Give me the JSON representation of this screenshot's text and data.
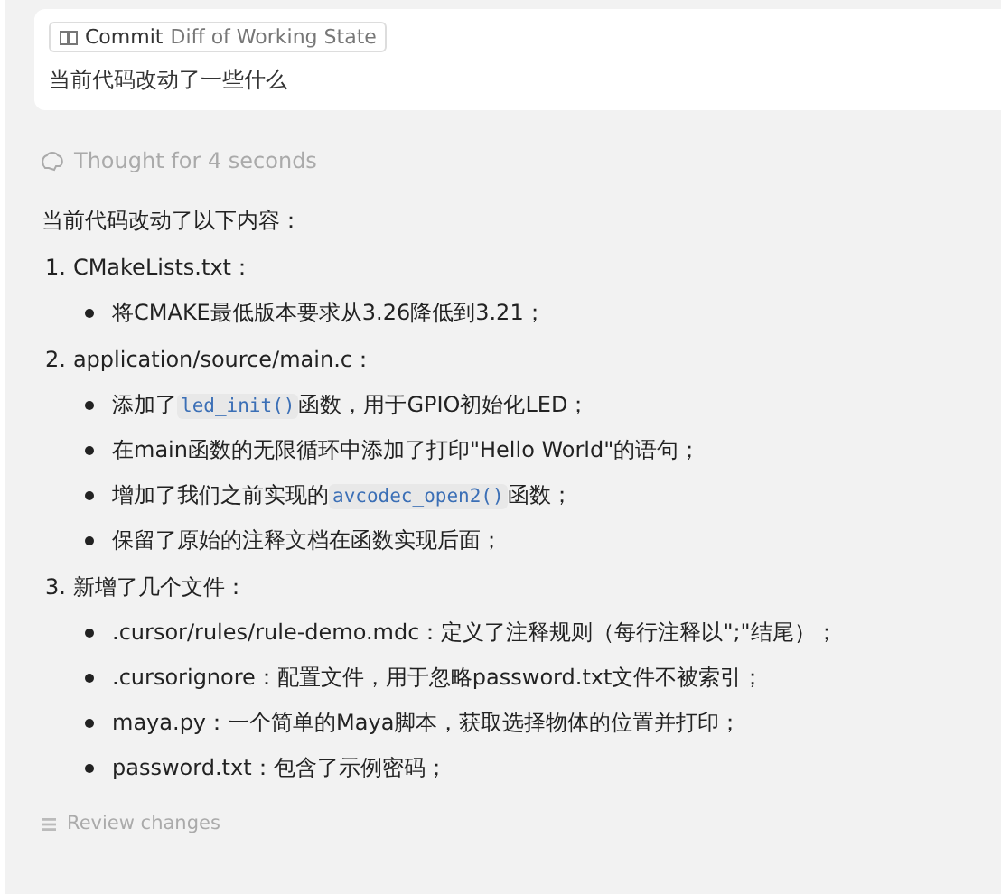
{
  "prompt_card": {
    "tag": {
      "label": "Commit",
      "detail": "Diff of Working State"
    },
    "message": "当前代码改动了一些什么"
  },
  "thought": {
    "label": "Thought for 4 seconds"
  },
  "answer": {
    "intro": "当前代码改动了以下内容：",
    "sections": [
      {
        "number": "1.",
        "title": "CMakeLists.txt：",
        "bullets": [
          [
            {
              "kind": "text",
              "text": "将CMAKE最低版本要求从3.26降低到3.21；"
            }
          ]
        ]
      },
      {
        "number": "2.",
        "title": "application/source/main.c：",
        "bullets": [
          [
            {
              "kind": "text",
              "text": "添加了"
            },
            {
              "kind": "code",
              "text": "led_init()"
            },
            {
              "kind": "text",
              "text": "函数，用于GPIO初始化LED；"
            }
          ],
          [
            {
              "kind": "text",
              "text": "在main函数的无限循环中添加了打印\"Hello World\"的语句；"
            }
          ],
          [
            {
              "kind": "text",
              "text": "增加了我们之前实现的"
            },
            {
              "kind": "code",
              "text": "avcodec_open2()"
            },
            {
              "kind": "text",
              "text": "函数；"
            }
          ],
          [
            {
              "kind": "text",
              "text": "保留了原始的注释文档在函数实现后面；"
            }
          ]
        ]
      },
      {
        "number": "3.",
        "title": "新增了几个文件：",
        "bullets": [
          [
            {
              "kind": "text",
              "text": ".cursor/rules/rule-demo.mdc：定义了注释规则（每行注释以\";\"结尾）；"
            }
          ],
          [
            {
              "kind": "text",
              "text": ".cursorignore：配置文件，用于忽略password.txt文件不被索引；"
            }
          ],
          [
            {
              "kind": "text",
              "text": "maya.py：一个简单的Maya脚本，获取选择物体的位置并打印；"
            }
          ],
          [
            {
              "kind": "text",
              "text": "password.txt：包含了示例密码；"
            }
          ]
        ]
      }
    ]
  },
  "review": {
    "label": "Review changes"
  }
}
